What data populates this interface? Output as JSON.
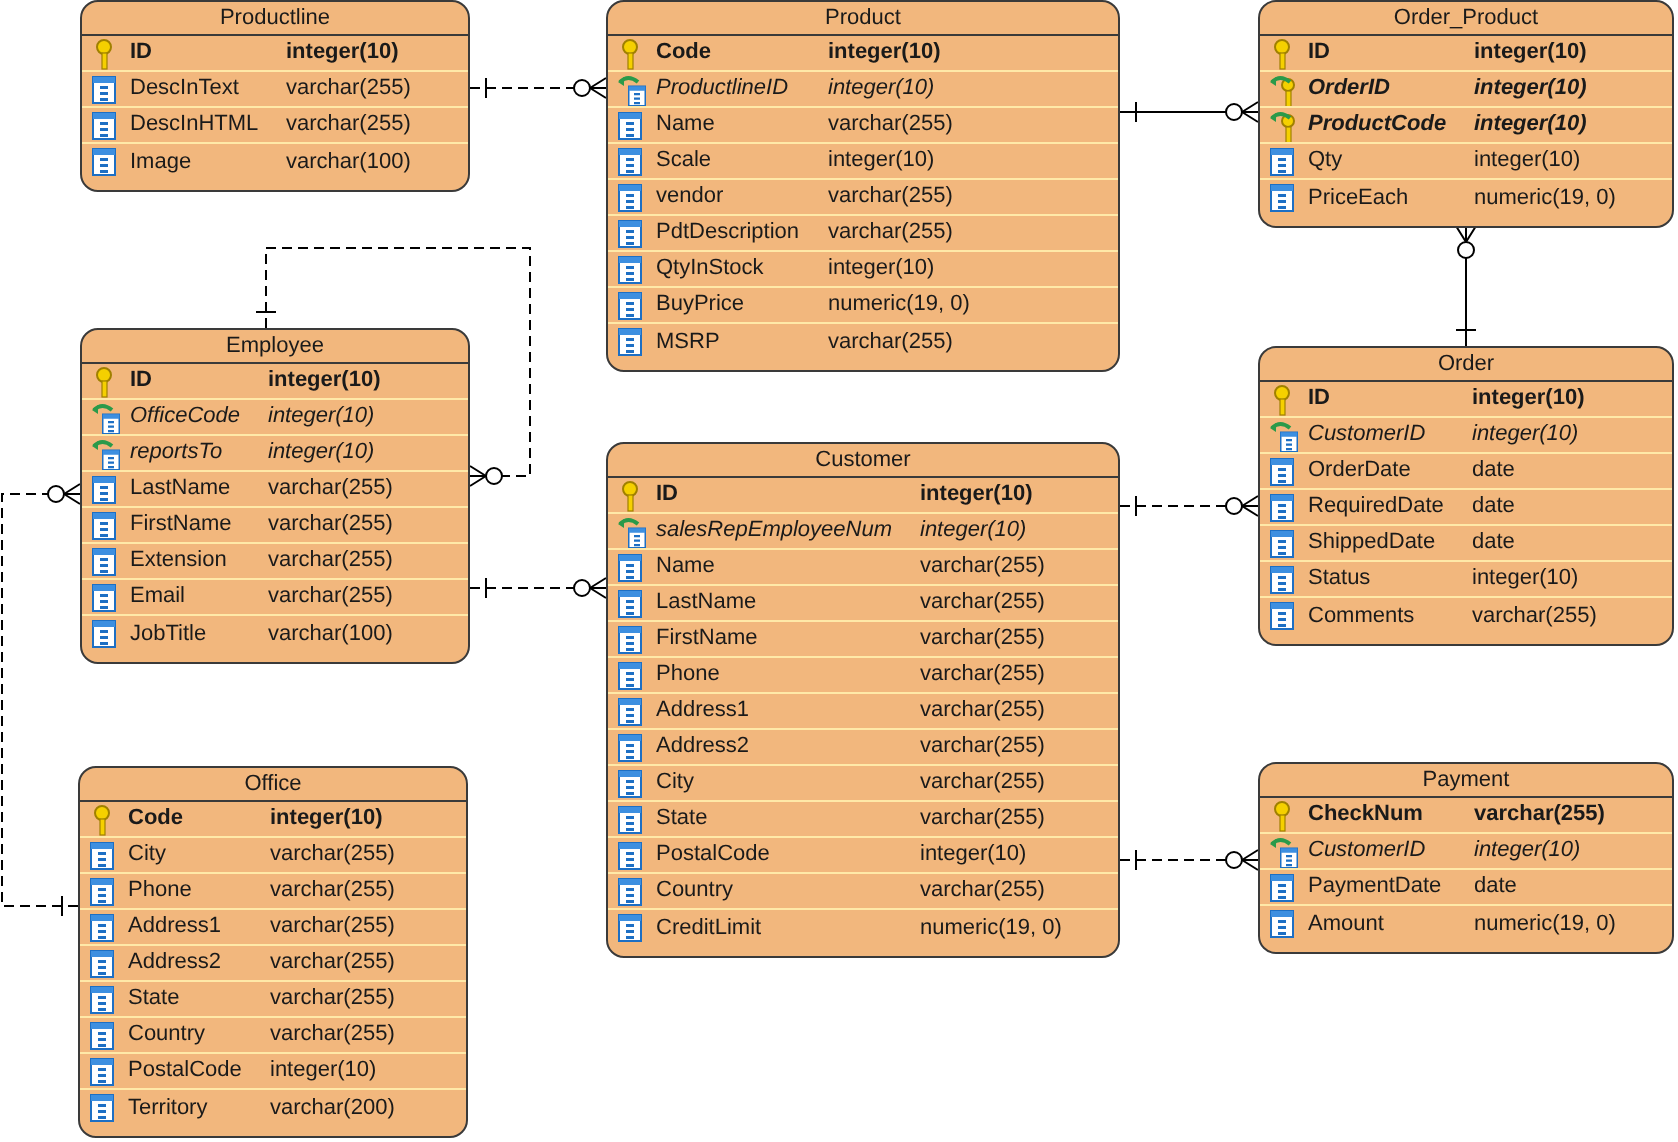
{
  "entities": [
    {
      "title": "Productline",
      "columns": [
        {
          "kind": "pk",
          "name": "ID",
          "type": "integer(10)"
        },
        {
          "kind": "column",
          "name": "DescInText",
          "type": "varchar(255)"
        },
        {
          "kind": "column",
          "name": "DescInHTML",
          "type": "varchar(255)"
        },
        {
          "kind": "column",
          "name": "Image",
          "type": "varchar(100)"
        }
      ]
    },
    {
      "title": "Product",
      "columns": [
        {
          "kind": "pk",
          "name": "Code",
          "type": "integer(10)"
        },
        {
          "kind": "fk",
          "name": "ProductlineID",
          "type": "integer(10)"
        },
        {
          "kind": "column",
          "name": "Name",
          "type": "varchar(255)"
        },
        {
          "kind": "column",
          "name": "Scale",
          "type": "integer(10)"
        },
        {
          "kind": "column",
          "name": "vendor",
          "type": "varchar(255)"
        },
        {
          "kind": "column",
          "name": "PdtDescription",
          "type": "varchar(255)"
        },
        {
          "kind": "column",
          "name": "QtyInStock",
          "type": "integer(10)"
        },
        {
          "kind": "column",
          "name": "BuyPrice",
          "type": "numeric(19, 0)"
        },
        {
          "kind": "column",
          "name": "MSRP",
          "type": "varchar(255)"
        }
      ]
    },
    {
      "title": "Order_Product",
      "columns": [
        {
          "kind": "pk",
          "name": "ID",
          "type": "integer(10)"
        },
        {
          "kind": "pfk",
          "name": "OrderID",
          "type": "integer(10)"
        },
        {
          "kind": "pfk",
          "name": "ProductCode",
          "type": "integer(10)"
        },
        {
          "kind": "column",
          "name": "Qty",
          "type": "integer(10)"
        },
        {
          "kind": "column",
          "name": "PriceEach",
          "type": "numeric(19, 0)"
        }
      ]
    },
    {
      "title": "Employee",
      "columns": [
        {
          "kind": "pk",
          "name": "ID",
          "type": "integer(10)"
        },
        {
          "kind": "fk",
          "name": "OfficeCode",
          "type": "integer(10)"
        },
        {
          "kind": "fk",
          "name": "reportsTo",
          "type": "integer(10)"
        },
        {
          "kind": "column",
          "name": "LastName",
          "type": "varchar(255)"
        },
        {
          "kind": "column",
          "name": "FirstName",
          "type": "varchar(255)"
        },
        {
          "kind": "column",
          "name": "Extension",
          "type": "varchar(255)"
        },
        {
          "kind": "column",
          "name": "Email",
          "type": "varchar(255)"
        },
        {
          "kind": "column",
          "name": "JobTitle",
          "type": "varchar(100)"
        }
      ]
    },
    {
      "title": "Customer",
      "columns": [
        {
          "kind": "pk",
          "name": "ID",
          "type": "integer(10)"
        },
        {
          "kind": "fk",
          "name": "salesRepEmployeeNum",
          "type": "integer(10)"
        },
        {
          "kind": "column",
          "name": "Name",
          "type": "varchar(255)"
        },
        {
          "kind": "column",
          "name": "LastName",
          "type": "varchar(255)"
        },
        {
          "kind": "column",
          "name": "FirstName",
          "type": "varchar(255)"
        },
        {
          "kind": "column",
          "name": "Phone",
          "type": "varchar(255)"
        },
        {
          "kind": "column",
          "name": "Address1",
          "type": "varchar(255)"
        },
        {
          "kind": "column",
          "name": "Address2",
          "type": "varchar(255)"
        },
        {
          "kind": "column",
          "name": "City",
          "type": "varchar(255)"
        },
        {
          "kind": "column",
          "name": "State",
          "type": "varchar(255)"
        },
        {
          "kind": "column",
          "name": "PostalCode",
          "type": "integer(10)"
        },
        {
          "kind": "column",
          "name": "Country",
          "type": "varchar(255)"
        },
        {
          "kind": "column",
          "name": "CreditLimit",
          "type": "numeric(19, 0)"
        }
      ]
    },
    {
      "title": "Order",
      "columns": [
        {
          "kind": "pk",
          "name": "ID",
          "type": "integer(10)"
        },
        {
          "kind": "fk",
          "name": "CustomerID",
          "type": "integer(10)"
        },
        {
          "kind": "column",
          "name": "OrderDate",
          "type": "date"
        },
        {
          "kind": "column",
          "name": "RequiredDate",
          "type": "date"
        },
        {
          "kind": "column",
          "name": "ShippedDate",
          "type": "date"
        },
        {
          "kind": "column",
          "name": "Status",
          "type": "integer(10)"
        },
        {
          "kind": "column",
          "name": "Comments",
          "type": "varchar(255)"
        }
      ]
    },
    {
      "title": "Office",
      "columns": [
        {
          "kind": "pk",
          "name": "Code",
          "type": "integer(10)"
        },
        {
          "kind": "column",
          "name": "City",
          "type": "varchar(255)"
        },
        {
          "kind": "column",
          "name": "Phone",
          "type": "varchar(255)"
        },
        {
          "kind": "column",
          "name": "Address1",
          "type": "varchar(255)"
        },
        {
          "kind": "column",
          "name": "Address2",
          "type": "varchar(255)"
        },
        {
          "kind": "column",
          "name": "State",
          "type": "varchar(255)"
        },
        {
          "kind": "column",
          "name": "Country",
          "type": "varchar(255)"
        },
        {
          "kind": "column",
          "name": "PostalCode",
          "type": "integer(10)"
        },
        {
          "kind": "column",
          "name": "Territory",
          "type": "varchar(200)"
        }
      ]
    },
    {
      "title": "Payment",
      "columns": [
        {
          "kind": "pk",
          "name": "CheckNum",
          "type": "varchar(255)"
        },
        {
          "kind": "fk",
          "name": "CustomerID",
          "type": "integer(10)"
        },
        {
          "kind": "column",
          "name": "PaymentDate",
          "type": "date"
        },
        {
          "kind": "column",
          "name": "Amount",
          "type": "numeric(19, 0)"
        }
      ]
    }
  ],
  "relationships": [
    {
      "identifying": false
    },
    {
      "identifying": true
    },
    {
      "identifying": true
    },
    {
      "identifying": false
    },
    {
      "identifying": false
    },
    {
      "identifying": false
    },
    {
      "identifying": false
    },
    {
      "identifying": false
    }
  ]
}
